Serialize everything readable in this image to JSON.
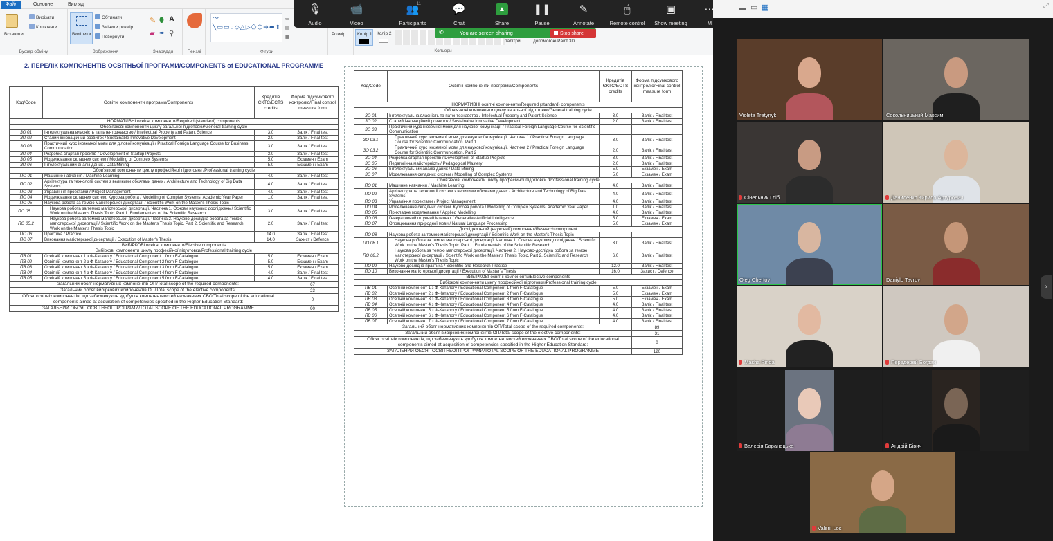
{
  "paint": {
    "tabs": [
      "Файл",
      "Основне",
      "Вигляд"
    ],
    "ribbon": {
      "clipboard": {
        "paste": "Вставити",
        "cut": "Вирізати",
        "copy": "Копіювати",
        "label": "Буфер обміну"
      },
      "image": {
        "select": "Виділити",
        "crop": "Обтинати",
        "resize": "Змінити розмір",
        "rotate": "Повернути",
        "label": "Зображення"
      },
      "tools": {
        "label": "Знаряддя"
      },
      "brushes": {
        "label": "Пензлі"
      },
      "shapes": {
        "label": "Фігури"
      },
      "size": {
        "label": "Розмір"
      },
      "color1": {
        "label": "Колір 1"
      },
      "color2": {
        "label": "Колір 2"
      },
      "colors": {
        "label": "Кольори"
      },
      "palette": {
        "label": "палітри"
      },
      "paint3d": {
        "label": "допомогою Paint 3D"
      }
    }
  },
  "zoom": {
    "toolbar": [
      {
        "label": "Audio",
        "icon": "microphone-icon",
        "glyph": "🎙"
      },
      {
        "label": "Video",
        "icon": "video-camera-icon",
        "glyph": "📹"
      },
      {
        "label": "Participants",
        "icon": "participants-icon",
        "glyph": "👥",
        "count": "11"
      },
      {
        "label": "Chat",
        "icon": "chat-icon",
        "glyph": "💬"
      },
      {
        "label": "Share",
        "icon": "share-screen-icon",
        "glyph": "▲"
      },
      {
        "label": "Pause",
        "icon": "pause-icon",
        "glyph": "❚❚"
      },
      {
        "label": "Annotate",
        "icon": "annotate-pen-icon",
        "glyph": "✎"
      },
      {
        "label": "Remote control",
        "icon": "remote-control-icon",
        "glyph": "🖱"
      },
      {
        "label": "Show meeting",
        "icon": "show-meeting-icon",
        "glyph": "▣"
      },
      {
        "label": "M",
        "icon": "more-icon",
        "glyph": "⋯"
      }
    ],
    "sharing_text": "You are screen sharing",
    "stop_share": "Stop share",
    "participants": [
      {
        "name": "Violeta Tretynyk",
        "mic_muted": false
      },
      {
        "name": "Сокольницький Максим",
        "mic_muted": false
      },
      {
        "name": "Сінельник Гліб",
        "mic_muted": true
      },
      {
        "name": "Даниленко Кирило Артурович",
        "mic_muted": true
      },
      {
        "name": "Oleg Chertov",
        "mic_muted": false,
        "speaking": true
      },
      {
        "name": "Daniylo Tavrov",
        "mic_muted": false
      },
      {
        "name": "Masha Pinda",
        "mic_muted": true
      },
      {
        "name": "Передерей Богдан",
        "mic_muted": true
      },
      {
        "name": "Валерія Баранецька",
        "mic_muted": true
      },
      {
        "name": "Андрій Бівич",
        "mic_muted": true
      },
      {
        "name": "Valerii Los",
        "mic_muted": true
      }
    ]
  },
  "document": {
    "title": "2. ПЕРЕЛІК КОМПОНЕНТІВ ОСВІТНЬОЇ ПРОГРАМИ/COMPONENTS of EDUCATIONAL PROGRAMME",
    "table1": {
      "headers": [
        "Код/Code",
        "Освітні компоненти програми/Components",
        "Кредитів ЄКТС/ECTS credits",
        "Форма підсумкового контролю/Final control measure form"
      ],
      "rows": [
        {
          "t": "sec",
          "text": "НОРМАТИВНІ освітні компоненти/Required (standard) components"
        },
        {
          "t": "sec",
          "text": "Обов'язкові компоненти циклу загальної підготовки/General training cycle"
        },
        {
          "t": "r",
          "c": "ЗО 01",
          "n": "Інтелектуальна власність та патентознавство / Intellectual Property and Patent Science",
          "e": "3.0",
          "f": "Залік / Final test"
        },
        {
          "t": "r",
          "c": "ЗО 02",
          "n": "Сталий інноваційний розвиток / Sustainable Innovative Development",
          "e": "2.0",
          "f": "Залік / Final test"
        },
        {
          "t": "r",
          "c": "ЗО 03",
          "n": "Практичний курс іноземної мови для ділової комунікації / Practical Foreign Language Course for Business Communication",
          "e": "3.0",
          "f": "Залік / Final test"
        },
        {
          "t": "r",
          "c": "ЗО 04",
          "n": "Розробка стартап проектів / Development of Startup Projects",
          "e": "3.0",
          "f": "Залік / Final test"
        },
        {
          "t": "r",
          "c": "ЗО 05",
          "n": "Моделювання складних систем / Modelling of Complex Systems",
          "e": "5.0",
          "f": "Екзамен / Exam"
        },
        {
          "t": "r",
          "c": "ЗО 06",
          "n": "Інтелектуальний аналіз даних / Data Mining",
          "e": "5.0",
          "f": "Екзамен / Exam"
        },
        {
          "t": "sec",
          "text": "Обов'язкові компоненти циклу професійної підготовки /Professional training cycle"
        },
        {
          "t": "r",
          "c": "ПО 01",
          "n": "Машинне навчання / Machine Learning",
          "e": "4.0",
          "f": "Залік / Final test"
        },
        {
          "t": "r",
          "c": "ПО 02",
          "n": "Архітектура та технології систем з великими обсягами даних / Architecture and Technology of Big Data Systems",
          "e": "4.0",
          "f": "Залік / Final test"
        },
        {
          "t": "r",
          "c": "ПО 03",
          "n": "Управління проектами / Project Management",
          "e": "4.0",
          "f": "Залік / Final test"
        },
        {
          "t": "r",
          "c": "ПО 04",
          "n": "Моделювання складних систем. Курсова робота / Modelling of Complex Systems. Academic Year Paper",
          "e": "1.0",
          "f": "Залік / Final test"
        },
        {
          "t": "r",
          "c": "ПО 05",
          "n": "Наукова робота за темою магістерської дисертації / Scientific Work on the Master's Thesis Topic",
          "e": "",
          "f": ""
        },
        {
          "t": "r",
          "c": "ПО 05.1",
          "n": "Наукова робота за темою магістерської дисертації. Частина 1. Основи наукових досліджень / Scientific Work on the Master's Thesis Topic. Part 1. Fundamentals of the Scientific Research",
          "e": "3.0",
          "f": "Залік / Final test",
          "ind": true
        },
        {
          "t": "r",
          "c": "ПО 05.2",
          "n": "Наукова робота за темою магістерської дисертації. Частина 2. Науково-дослідна робота за темою магістерської дисертації / Scientific Work on the Master's Thesis Topic. Part 2. Scientific and Research Work on the Master's Thesis Topic",
          "e": "2.0",
          "f": "Залік / Final test",
          "ind": true
        },
        {
          "t": "r",
          "c": "ПО 06",
          "n": "Практика / Practice",
          "e": "14.0",
          "f": "Залік / Final test"
        },
        {
          "t": "r",
          "c": "ПО 07",
          "n": "Виконання магістерської дисертації / Execution of Master's Thesis",
          "e": "14.0",
          "f": "Захист / Defence"
        },
        {
          "t": "sec",
          "text": "ВИБІРКОВІ освітні компоненти/Elective components"
        },
        {
          "t": "sec",
          "text": "Вибіркові компоненти циклу професійної підготовки/Professional training cycle"
        },
        {
          "t": "r",
          "c": "ПВ 01",
          "n": "Освітній компонент 1 з Ф-Каталогу / Educational Component 1 from F-Catalogue",
          "e": "5.0",
          "f": "Екзамен / Exam"
        },
        {
          "t": "r",
          "c": "ПВ 02",
          "n": "Освітній компонент 2 з Ф-Каталогу / Educational Component 2 from F-Catalogue",
          "e": "5.0",
          "f": "Екзамен / Exam"
        },
        {
          "t": "r",
          "c": "ПВ 03",
          "n": "Освітній компонент 3 з Ф-Каталогу / Educational Component 3 from F-Catalogue",
          "e": "5.0",
          "f": "Екзамен / Exam"
        },
        {
          "t": "r",
          "c": "ПВ 04",
          "n": "Освітній компонент 4 з Ф-Каталогу / Educational Component 4 from F-Catalogue",
          "e": "4.0",
          "f": "Залік / Final test"
        },
        {
          "t": "r",
          "c": "ПВ 05",
          "n": "Освітній компонент 5 з Ф-Каталогу / Educational Component 5 from F-Catalogue",
          "e": "4.0",
          "f": "Залік / Final test"
        },
        {
          "t": "tot",
          "text": "Загальний обсяг нормативних компонентів ОП/Total scope of the required components:",
          "e": "67"
        },
        {
          "t": "tot",
          "text": "Загальний обсяг вибіркових компонентів ОП/Total scope of the elective components:",
          "e": "23"
        },
        {
          "t": "tot",
          "text": "Обсяг освітніх компонентів, що забезпечують здобуття компетентностей визначених СВО/Total scope of the educational components aimed at acquisition of competencies specified in the Higher Education Standard:",
          "e": "0"
        },
        {
          "t": "tot",
          "text": "ЗАГАЛЬНИЙ ОБСЯГ ОСВІТНЬОЇ ПРОГРАМИ/TOTAL SCOPE OF THE EDUCATIONAL PROGRAMME",
          "e": "90"
        }
      ]
    },
    "table2": {
      "headers": [
        "Код/Code",
        "Освітні компоненти програми/Components",
        "Кредитів ЄКТС/ECTS credits",
        "Форма підсумкового контролю/Final control measure form"
      ],
      "rows": [
        {
          "t": "sec",
          "text": "НОРМАТИВНІ освітні компоненти/Required (standard) components"
        },
        {
          "t": "sec",
          "text": "Обов'язкові компоненти циклу загальної підготовки/General training cycle"
        },
        {
          "t": "r",
          "c": "ЗО 01",
          "n": "Інтелектуальна власність та патентознавство / Intellectual Property and Patent Science",
          "e": "3.0",
          "f": "Залік / Final test"
        },
        {
          "t": "r",
          "c": "ЗО 02",
          "n": "Сталий інноваційний розвиток / Sustainable Innovative Development",
          "e": "2.0",
          "f": "Залік / Final test"
        },
        {
          "t": "r",
          "c": "ЗО 03",
          "n": "Практичний курс іноземної мови для наукової комунікації / Practical Foreign Language Course for Scientific Communication",
          "e": "",
          "f": ""
        },
        {
          "t": "r",
          "c": "ЗО 03.1",
          "n": "Практичний курс іноземної мови для наукової комунікації. Частина 1 / Practical Foreign Language Course for Scientific Communication. Part 1",
          "e": "3.0",
          "f": "Залік / Final test",
          "ind": true
        },
        {
          "t": "r",
          "c": "ЗО 03.2",
          "n": "Практичний курс іноземної мови для наукової комунікації. Частина 2 / Practical Foreign Language Course for Scientific Communication. Part 2",
          "e": "2.0",
          "f": "Залік / Final test",
          "ind": true
        },
        {
          "t": "r",
          "c": "ЗО 04",
          "n": "Розробка стартап проектів / Development of Startup Projects",
          "e": "3.0",
          "f": "Залік / Final test"
        },
        {
          "t": "r",
          "c": "ЗО 05",
          "n": "Педагогічна майстерність / Pedagogical Mastery",
          "e": "2.0",
          "f": "Залік / Final test"
        },
        {
          "t": "r",
          "c": "ЗО 06",
          "n": "Інтелектуальний аналіз даних / Data Mining",
          "e": "5.0",
          "f": "Екзамен / Exam"
        },
        {
          "t": "r",
          "c": "ЗО 07",
          "n": "Моделювання складних систем / Modelling of Complex Systems",
          "e": "5.0",
          "f": "Екзамен / Exam"
        },
        {
          "t": "sec",
          "text": "Обов'язкові компоненти циклу професійної підготовки /Professional training cycle"
        },
        {
          "t": "r",
          "c": "ПО 01",
          "n": "Машинне навчання / Machine Learning",
          "e": "4.0",
          "f": "Залік / Final test"
        },
        {
          "t": "r",
          "c": "ПО 02",
          "n": "Архітектура та технології систем з великими обсягами даних / Architecture and Technology of Big Data Systems",
          "e": "4.0",
          "f": "Залік / Final test"
        },
        {
          "t": "r",
          "c": "ПО 03",
          "n": "Управління проектами / Project Management",
          "e": "4.0",
          "f": "Залік / Final test"
        },
        {
          "t": "r",
          "c": "ПО 04",
          "n": "Моделювання складних систем. Курсова робота / Modelling of Complex Systems. Academic Year Paper",
          "e": "1.0",
          "f": "Залік / Final test"
        },
        {
          "t": "r",
          "c": "ПО 05",
          "n": "Прикладне моделювання / Applied Modelling",
          "e": "4.0",
          "f": "Залік / Final test"
        },
        {
          "t": "r",
          "c": "ПО 06",
          "n": "Генеративний штучний інтелект / Generative Artificial Intelligence",
          "e": "5.0",
          "f": "Екзамен / Exam"
        },
        {
          "t": "r",
          "c": "ПО 07",
          "n": "Опрацювання природної мови / Natural Language Processing",
          "e": "5.0",
          "f": "Екзамен / Exam"
        },
        {
          "t": "sec",
          "text": "Дослідницький (науковий) компонент/Research component"
        },
        {
          "t": "r",
          "c": "ПО 08",
          "n": "Наукова робота за темою магістерської дисертації / Scientific Work on the Master's Thesis Topic",
          "e": "",
          "f": ""
        },
        {
          "t": "r",
          "c": "ПО 08.1",
          "n": "Наукова робота за темою магістерської дисертації. Частина 1. Основи наукових досліджень / Scientific Work on the Master's Thesis Topic. Part 1. Fundamentals of the Scientific Research",
          "e": "3.0",
          "f": "Залік / Final test",
          "ind": true
        },
        {
          "t": "r",
          "c": "ПО 08.2",
          "n": "Наукова робота за темою магістерської дисертації. Частина 2. Науково-дослідна робота за темою магістерської дисертації / Scientific Work on the Master's Thesis Topic. Part 2. Scientific and Research Work on the Master's Thesis Topic",
          "e": "6.0",
          "f": "Залік / Final test",
          "ind": true
        },
        {
          "t": "r",
          "c": "ПО 09",
          "n": "Науково-дослідна практика / Scientific and Research Practice",
          "e": "12.0",
          "f": "Залік / Final test"
        },
        {
          "t": "r",
          "c": "ПО 10",
          "n": "Виконання магістерської дисертації / Execution of Master's Thesis",
          "e": "16.0",
          "f": "Захист / Defence"
        },
        {
          "t": "sec",
          "text": "ВИБІРКОВІ освітні компоненти/Elective components"
        },
        {
          "t": "sec",
          "text": "Вибіркові компоненти циклу професійної підготовки/Professional training cycle"
        },
        {
          "t": "r",
          "c": "ПВ 01",
          "n": "Освітній компонент 1 з Ф-Каталогу / Educational Component 1 from F-Catalogue",
          "e": "5.0",
          "f": "Екзамен / Exam"
        },
        {
          "t": "r",
          "c": "ПВ 02",
          "n": "Освітній компонент 2 з Ф-Каталогу / Educational Component 2 from F-Catalogue",
          "e": "5.0",
          "f": "Екзамен / Exam"
        },
        {
          "t": "r",
          "c": "ПВ 03",
          "n": "Освітній компонент 3 з Ф-Каталогу / Educational Component 3 from F-Catalogue",
          "e": "5.0",
          "f": "Екзамен / Exam"
        },
        {
          "t": "r",
          "c": "ПВ 04",
          "n": "Освітній компонент 4 з Ф-Каталогу / Educational Component 4 from F-Catalogue",
          "e": "4.0",
          "f": "Залік / Final test"
        },
        {
          "t": "r",
          "c": "ПВ 05",
          "n": "Освітній компонент 5 з Ф-Каталогу / Educational Component 5 from F-Catalogue",
          "e": "4.0",
          "f": "Залік / Final test"
        },
        {
          "t": "r",
          "c": "ПВ 06",
          "n": "Освітній компонент 6 з Ф-Каталогу / Educational Component 6 from F-Catalogue",
          "e": "4.0",
          "f": "Залік / Final test"
        },
        {
          "t": "r",
          "c": "ПВ 07",
          "n": "Освітній компонент 7 з Ф-Каталогу / Educational Component 7 from F-Catalogue",
          "e": "4.0",
          "f": "Залік / Final test"
        },
        {
          "t": "tot",
          "text": "Загальний обсяг нормативних компонентів ОП/Total scope of the required components:",
          "e": "89"
        },
        {
          "t": "tot",
          "text": "Загальний обсяг вибіркових компонентів ОП/Total scope of the elective components:",
          "e": "31"
        },
        {
          "t": "tot",
          "text": "Обсяг освітніх компонентів, що забезпечують здобуття компетентностей визначених СВО/Total scope of the educational components aimed at acquisition of competencies specified in the Higher Education Standard:",
          "e": "0"
        },
        {
          "t": "tot",
          "text": "ЗАГАЛЬНИЙ ОБСЯГ ОСВІТНЬОЇ ПРОГРАМИ/TOTAL SCOPE OF THE EDUCATIONAL PROGRAMME",
          "e": "120"
        }
      ]
    }
  },
  "colors": {
    "accent": "#1b6ec2",
    "share_green": "#2e9e3e",
    "stop_red": "#d53636",
    "speaking": "#2cc34a"
  }
}
